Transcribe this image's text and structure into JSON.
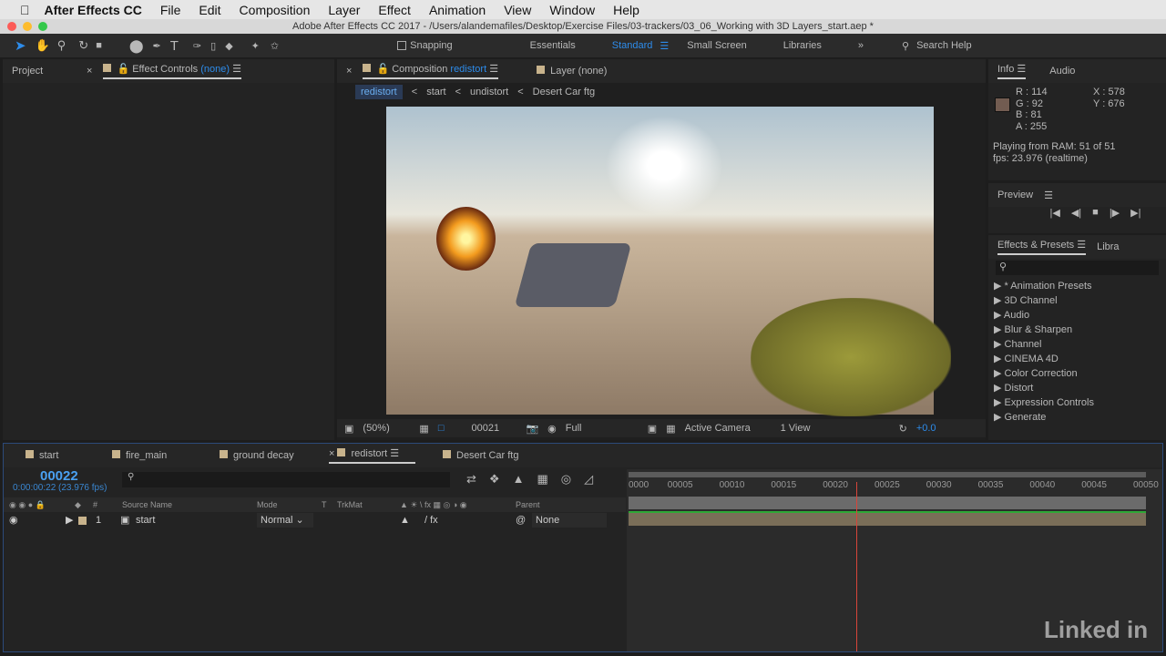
{
  "menubar": {
    "app": "After Effects CC",
    "items": [
      "File",
      "Edit",
      "Composition",
      "Layer",
      "Effect",
      "Animation",
      "View",
      "Window",
      "Help"
    ]
  },
  "window_title": "Adobe After Effects CC 2017 - /Users/alandemafiles/Desktop/Exercise Files/03-trackers/03_06_Working with 3D Layers_start.aep *",
  "toolbar": {
    "snapping": "Snapping",
    "workspaces": [
      "Essentials",
      "Standard",
      "Small Screen",
      "Libraries"
    ],
    "active_workspace": "Standard",
    "search": "Search Help"
  },
  "left_panel": {
    "project": "Project",
    "effect_controls": "Effect Controls",
    "effect_controls_target": "(none)"
  },
  "comp_panel": {
    "label": "Composition",
    "comp_name": "redistort",
    "layer_tab": "Layer (none)",
    "breadcrumb": [
      "redistort",
      "start",
      "undistort",
      "Desert Car ftg"
    ],
    "footer": {
      "zoom": "(50%)",
      "frame": "00021",
      "resolution": "Full",
      "camera": "Active Camera",
      "views": "1 View",
      "exposure": "+0.0"
    }
  },
  "info": {
    "tab": "Info",
    "audio_tab": "Audio",
    "r": "R : 114",
    "g": "G : 92",
    "b": "B : 81",
    "a": "A : 255",
    "x": "X : 578",
    "y": "Y : 676",
    "swatch": "#725c51",
    "ram": "Playing from RAM: 51 of 51",
    "fps": "fps: 23.976 (realtime)"
  },
  "preview": {
    "title": "Preview"
  },
  "effects": {
    "title": "Effects & Presets",
    "libra": "Libra",
    "items": [
      "* Animation Presets",
      "3D Channel",
      "Audio",
      "Blur & Sharpen",
      "Channel",
      "CINEMA 4D",
      "Color Correction",
      "Distort",
      "Expression Controls",
      "Generate"
    ]
  },
  "timeline": {
    "tabs": [
      "start",
      "fire_main",
      "ground decay",
      "redistort",
      "Desert Car ftg"
    ],
    "active_tab": "redistort",
    "timecode": "00022",
    "timecode_sub": "0:00:00:22 (23.976 fps)",
    "columns": {
      "num": "#",
      "source": "Source Name",
      "mode": "Mode",
      "t": "T",
      "trkmat": "TrkMat",
      "parent": "Parent"
    },
    "layers": [
      {
        "num": "1",
        "name": "start",
        "mode": "Normal",
        "parent": "None"
      }
    ],
    "ruler": [
      "0000",
      "00005",
      "00010",
      "00015",
      "00020",
      "00025",
      "00030",
      "00035",
      "00040",
      "00045",
      "00050"
    ],
    "playhead_frame": 22,
    "total_frames": 51
  },
  "watermark": "Linked in"
}
